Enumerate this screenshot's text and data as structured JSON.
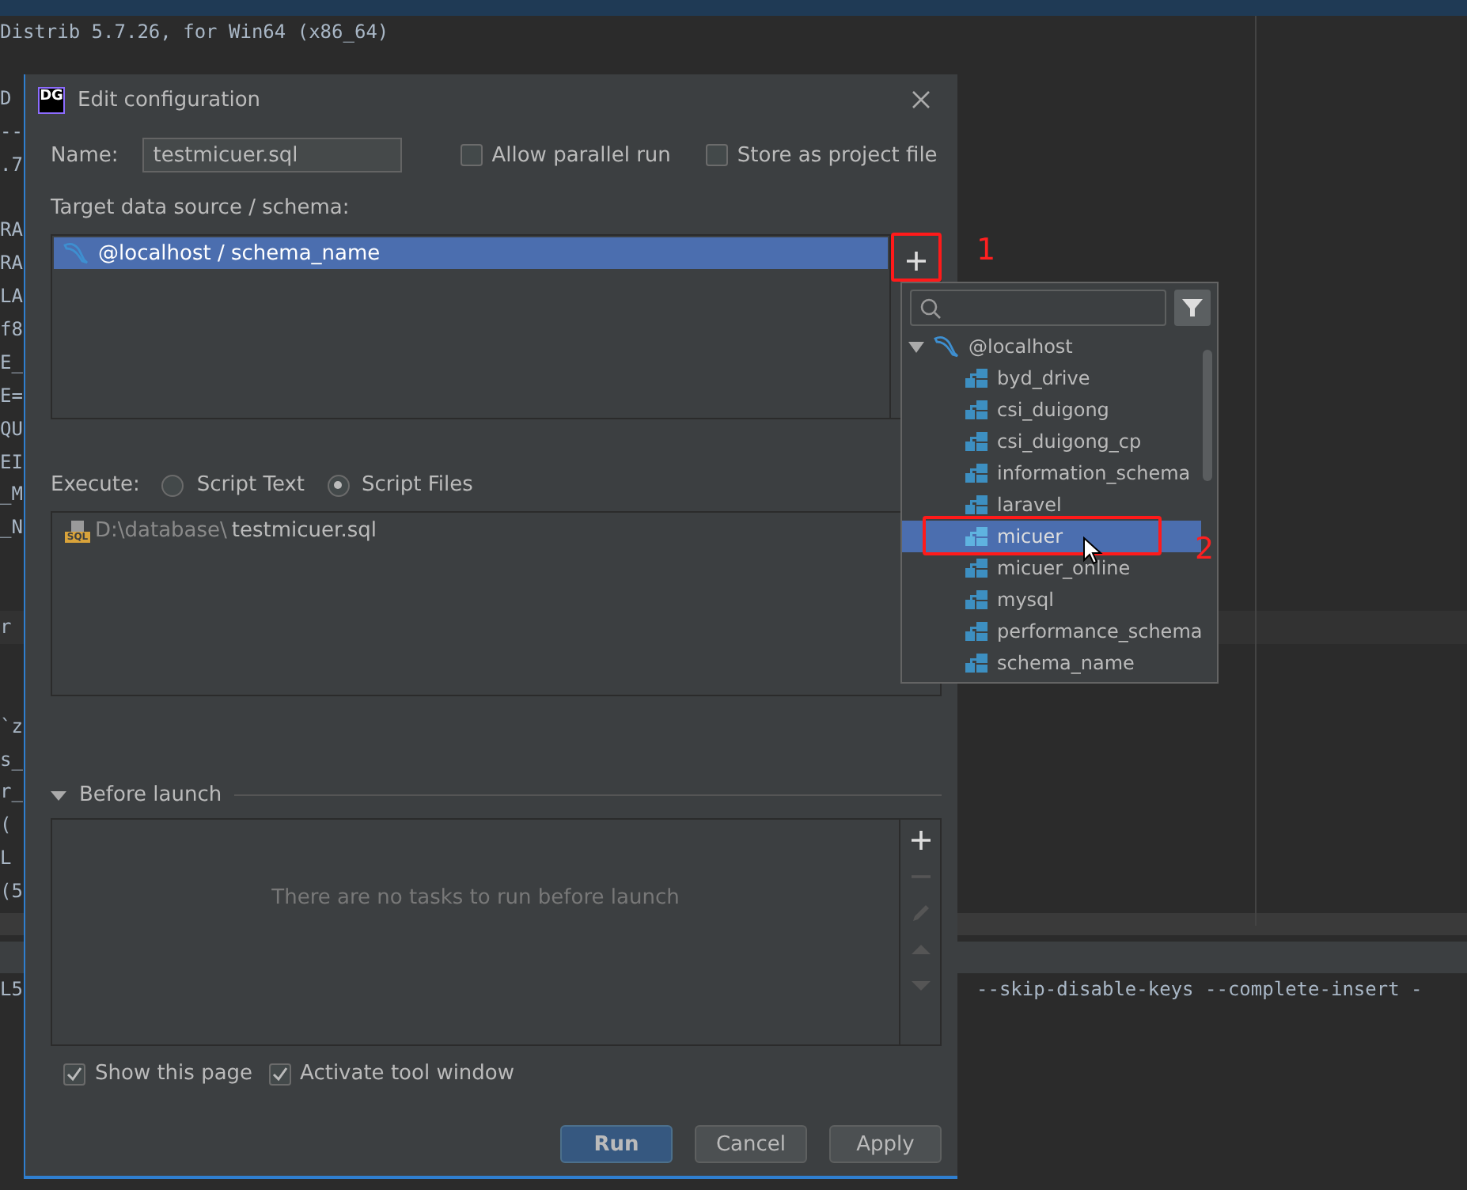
{
  "background_editor": {
    "lines": [
      {
        "kind": "text",
        "text": "Distrib 5.7.26, for Win64 (x86_64)"
      },
      {
        "kind": "blank"
      },
      {
        "kind": "text",
        "text": "D"
      },
      {
        "kind": "text",
        "text": "--"
      },
      {
        "kind": "text",
        "text": ".7"
      },
      {
        "kind": "blank"
      },
      {
        "kind": "text",
        "text": "RA"
      },
      {
        "kind": "text",
        "text": "RA"
      },
      {
        "kind": "text",
        "text": "LA"
      },
      {
        "kind": "text",
        "text": "f8"
      },
      {
        "kind": "text",
        "text": "E_"
      },
      {
        "kind": "text",
        "text": "E="
      },
      {
        "kind": "text",
        "text": "QU"
      },
      {
        "kind": "text",
        "text": "EI"
      },
      {
        "kind": "text",
        "text": "_M"
      },
      {
        "kind": "text",
        "text": "_N"
      },
      {
        "kind": "blank"
      },
      {
        "kind": "blank"
      },
      {
        "kind": "highlight",
        "text": "r"
      },
      {
        "kind": "blank"
      },
      {
        "kind": "blank"
      },
      {
        "kind": "text",
        "text": "`z"
      },
      {
        "kind": "text",
        "text": "s_"
      },
      {
        "kind": "text",
        "text": "r_"
      },
      {
        "kind": "text",
        "text": "("
      },
      {
        "kind": "text",
        "text": "L"
      },
      {
        "kind": "text",
        "text": "(5"
      },
      {
        "kind": "band"
      },
      {
        "kind": "header"
      },
      {
        "kind": "split",
        "text": "L5",
        "right_text": "--skip-disable-keys --complete-insert -"
      }
    ]
  },
  "dialog": {
    "logo_text": "DG",
    "title": "Edit configuration",
    "name_label": "Name:",
    "name_value": "testmicuer.sql",
    "options": [
      {
        "label": "Allow parallel run",
        "checked": false
      },
      {
        "label": "Store as project file",
        "checked": false
      }
    ],
    "target_label": "Target data source / schema:",
    "targets": [
      {
        "label": "@localhost / schema_name",
        "selected": true
      }
    ],
    "execute_label": "Execute:",
    "execute_options": [
      {
        "label": "Script Text",
        "selected": false
      },
      {
        "label": "Script Files",
        "selected": true
      }
    ],
    "files": [
      {
        "icon_text": "SQL",
        "folder": "D:\\database\\",
        "file": "testmicuer.sql"
      }
    ],
    "before_launch": {
      "title": "Before launch",
      "expanded": true,
      "empty_text": "There are no tasks to run before launch"
    },
    "bottom_options": [
      {
        "label": "Show this page",
        "checked": true
      },
      {
        "label": "Activate tool window",
        "checked": true
      }
    ],
    "buttons": [
      {
        "label": "Run",
        "kind": "primary"
      },
      {
        "label": "Cancel",
        "kind": "normal"
      },
      {
        "label": "Apply",
        "kind": "normal"
      }
    ]
  },
  "schema_popup": {
    "tree": [
      {
        "label": "@localhost",
        "expanded": true,
        "selected": false,
        "children": [
          {
            "label": "byd_drive",
            "selected": false
          },
          {
            "label": "csi_duigong",
            "selected": false
          },
          {
            "label": "csi_duigong_cp",
            "selected": false
          },
          {
            "label": "information_schema",
            "selected": false
          },
          {
            "label": "laravel",
            "selected": false
          },
          {
            "label": "micuer",
            "selected": true
          },
          {
            "label": "micuer_online",
            "selected": false
          },
          {
            "label": "mysql",
            "selected": false
          },
          {
            "label": "performance_schema",
            "selected": false
          },
          {
            "label": "schema_name",
            "selected": false
          }
        ]
      }
    ]
  },
  "annotations": [
    {
      "number": "1"
    },
    {
      "number": "2"
    }
  ]
}
